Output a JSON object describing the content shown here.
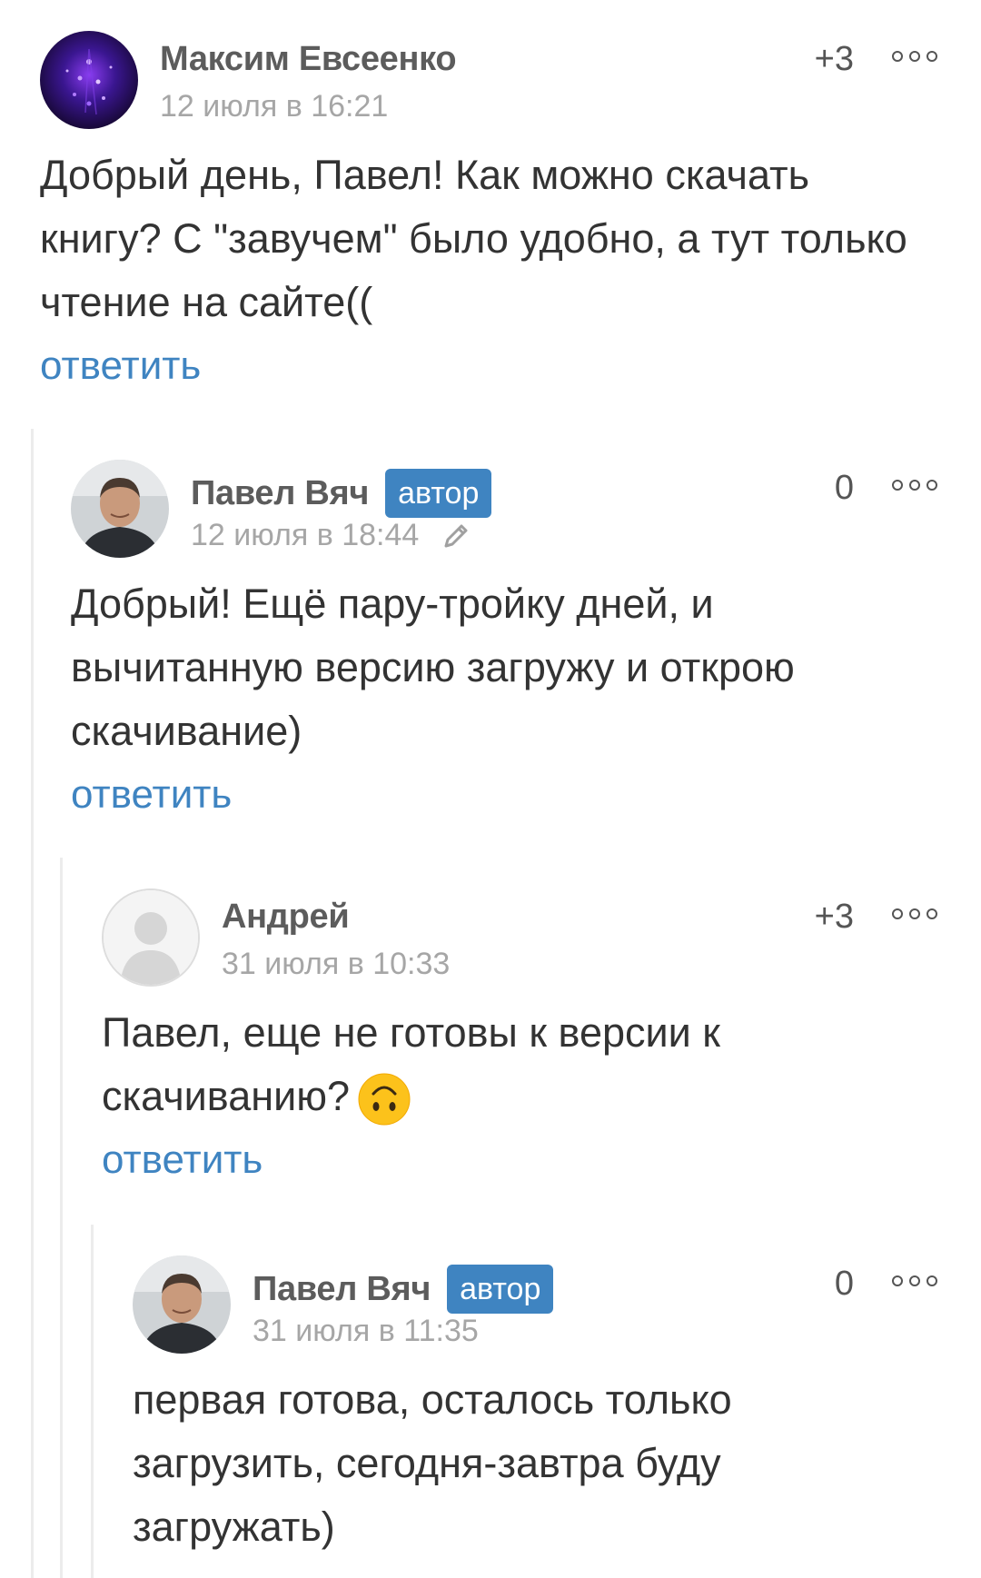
{
  "comments": [
    {
      "author": "Максим Евсеенко",
      "timestamp": "12 июля в 16:21",
      "score": "+3",
      "text": "Добрый день, Павел! Как можно скачать книгу? С \"завучем\" было удобно, а тут только чтение на сайте((",
      "reply_label": "ответить",
      "avatar_icon": "fireworks-avatar-icon"
    },
    {
      "author": "Павел Вяч",
      "badge": "автор",
      "timestamp": "12 июля в 18:44",
      "score": "0",
      "edited_icon": "pencil-icon",
      "text": "Добрый! Ещё пару-тройку дней, и вычитанную версию загружу и открою скачивание)",
      "reply_label": "ответить",
      "avatar_icon": "user-photo-icon"
    },
    {
      "author": "Андрей",
      "timestamp": "31 июля в 10:33",
      "score": "+3",
      "text": "Павел, еще не готовы к версии к скачиванию?",
      "emoji": "upside-down-face-emoji",
      "reply_label": "ответить",
      "avatar_icon": "default-user-avatar-icon"
    },
    {
      "author": "Павел Вяч",
      "badge": "автор",
      "timestamp": "31 июля в 11:35",
      "score": "0",
      "text": "первая готова, осталось только загрузить, сегодня-завтра буду загружать)",
      "avatar_icon": "user-photo-icon"
    }
  ],
  "colors": {
    "link": "#3f84c1",
    "badge_bg": "#3f84c1",
    "meta_text": "#a6a6a6",
    "author_text": "#5c5c5c"
  }
}
